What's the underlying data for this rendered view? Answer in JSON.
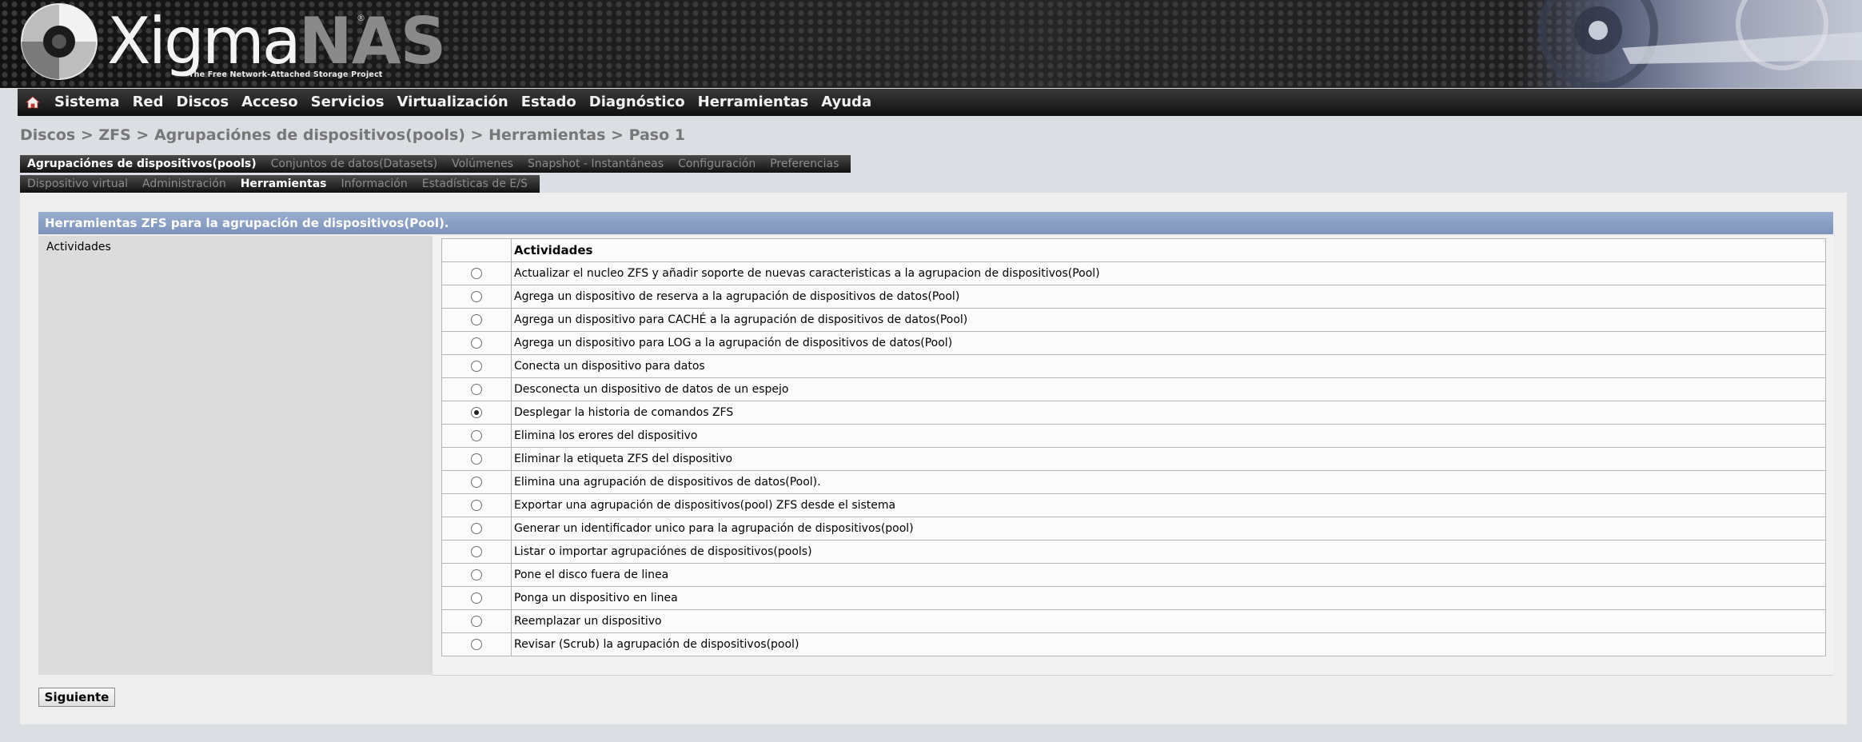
{
  "header": {
    "logo_main": "Xigma",
    "logo_accent": "NAS",
    "logo_registered": "®",
    "tagline": "The Free Network-Attached Storage Project"
  },
  "menu": {
    "home_icon": "home-icon",
    "items": [
      "Sistema",
      "Red",
      "Discos",
      "Acceso",
      "Servicios",
      "Virtualización",
      "Estado",
      "Diagnóstico",
      "Herramientas",
      "Ayuda"
    ]
  },
  "breadcrumb": "Discos > ZFS > Agrupaciónes de dispositivos(pools) > Herramientas > Paso 1",
  "tabs_primary": [
    {
      "label": "Agrupaciónes de dispositivos(pools)",
      "active": true
    },
    {
      "label": "Conjuntos de datos(Datasets)",
      "active": false
    },
    {
      "label": "Volúmenes",
      "active": false
    },
    {
      "label": "Snapshot - Instantáneas",
      "active": false
    },
    {
      "label": "Configuración",
      "active": false
    },
    {
      "label": "Preferencias",
      "active": false
    }
  ],
  "tabs_secondary": [
    {
      "label": "Dispositivo virtual",
      "active": false
    },
    {
      "label": "Administración",
      "active": false
    },
    {
      "label": "Herramientas",
      "active": true
    },
    {
      "label": "Información",
      "active": false
    },
    {
      "label": "Estadísticas de E/S",
      "active": false
    }
  ],
  "panel": {
    "title": "Herramientas ZFS para la agrupación de dispositivos(Pool).",
    "field_label": "Actividades",
    "table_header": "Actividades",
    "activities": [
      {
        "label": "Actualizar el nucleo ZFS y añadir soporte de nuevas caracteristicas a la agrupacion de dispositivos(Pool)",
        "selected": false
      },
      {
        "label": "Agrega un dispositivo de reserva a la agrupación de dispositivos de datos(Pool)",
        "selected": false
      },
      {
        "label": "Agrega un dispositivo para CACHÉ a la agrupación de dispositivos de datos(Pool)",
        "selected": false
      },
      {
        "label": "Agrega un dispositivo para LOG a la agrupación de dispositivos de datos(Pool)",
        "selected": false
      },
      {
        "label": "Conecta un dispositivo para datos",
        "selected": false
      },
      {
        "label": "Desconecta un dispositivo de datos de un espejo",
        "selected": false
      },
      {
        "label": "Desplegar la historia de comandos ZFS",
        "selected": true
      },
      {
        "label": "Elimina los erores del dispositivo",
        "selected": false
      },
      {
        "label": "Eliminar la etiqueta ZFS del dispositivo",
        "selected": false
      },
      {
        "label": "Elimina una agrupación de dispositivos de datos(Pool).",
        "selected": false
      },
      {
        "label": "Exportar una agrupación de dispositivos(pool) ZFS desde el sistema",
        "selected": false
      },
      {
        "label": "Generar un identificador unico para la agrupación de dispositivos(pool)",
        "selected": false
      },
      {
        "label": "Listar o importar agrupaciónes de dispositivos(pools)",
        "selected": false
      },
      {
        "label": "Pone el disco fuera de linea",
        "selected": false
      },
      {
        "label": "Ponga un dispositivo en linea",
        "selected": false
      },
      {
        "label": "Reemplazar un dispositivo",
        "selected": false
      },
      {
        "label": "Revisar (Scrub) la agrupación de dispositivos(pool)",
        "selected": false
      }
    ],
    "next_button": "Siguiente"
  }
}
